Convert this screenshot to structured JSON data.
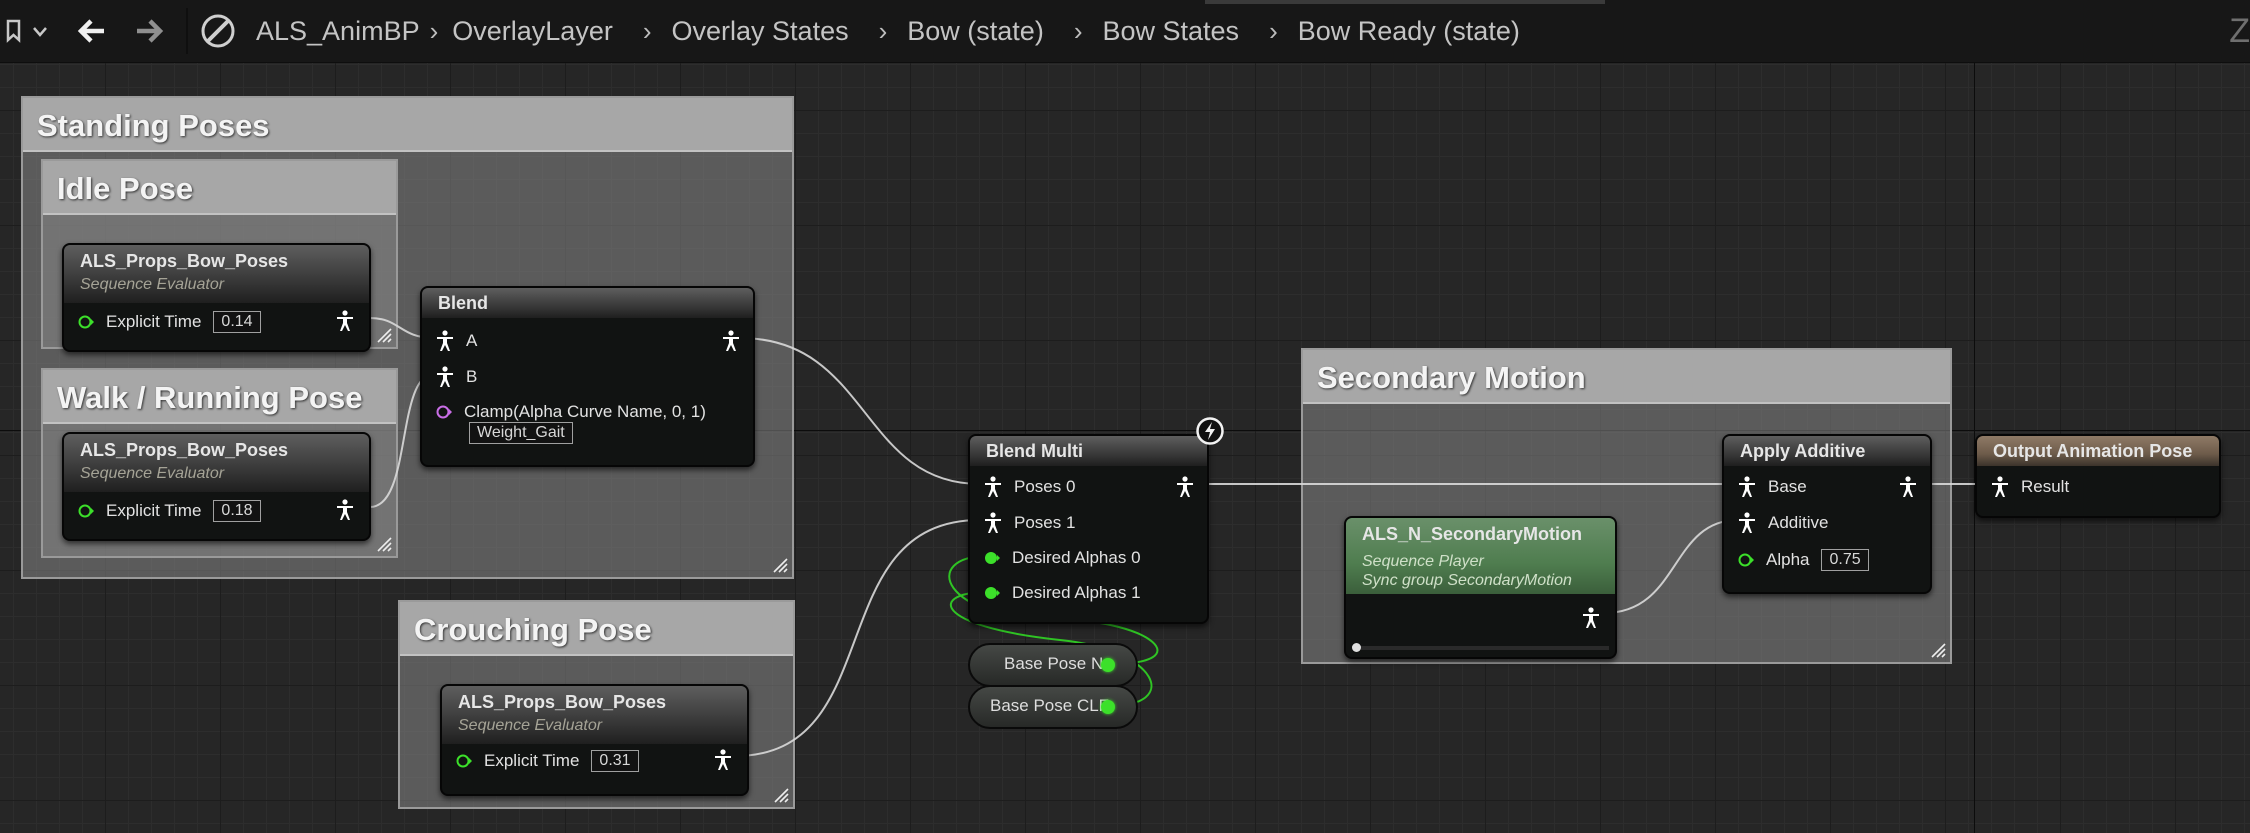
{
  "breadcrumb": {
    "items": [
      "ALS_AnimBP",
      "OverlayLayer",
      "Overlay States",
      "Bow (state)",
      "Bow States",
      "Bow Ready (state)"
    ]
  },
  "zoom_label": "Z",
  "comments": {
    "standing": "Standing Poses",
    "idle": "Idle Pose",
    "walk": "Walk / Running Pose",
    "crouch": "Crouching Pose",
    "secondary": "Secondary Motion"
  },
  "nodes": {
    "idle_eval": {
      "title": "ALS_Props_Bow_Poses",
      "subtitle": "Sequence Evaluator",
      "pin_label": "Explicit Time",
      "pin_value": "0.14"
    },
    "walk_eval": {
      "title": "ALS_Props_Bow_Poses",
      "subtitle": "Sequence Evaluator",
      "pin_label": "Explicit Time",
      "pin_value": "0.18"
    },
    "crouch_eval": {
      "title": "ALS_Props_Bow_Poses",
      "subtitle": "Sequence Evaluator",
      "pin_label": "Explicit Time",
      "pin_value": "0.31"
    },
    "blend": {
      "title": "Blend",
      "pin_a": "A",
      "pin_b": "B",
      "alpha_label": "Clamp(Alpha Curve Name, 0, 1)",
      "alpha_value": "Weight_Gait"
    },
    "blend_multi": {
      "title": "Blend Multi",
      "pins": [
        "Poses 0",
        "Poses 1",
        "Desired Alphas 0",
        "Desired Alphas 1"
      ]
    },
    "base_pose_n": {
      "label": "Base Pose N"
    },
    "base_pose_clf": {
      "label": "Base Pose CLF"
    },
    "seq_player": {
      "title": "ALS_N_SecondaryMotion",
      "subtitle": "Sequence Player",
      "subtitle2": "Sync group SecondaryMotion"
    },
    "apply_additive": {
      "title": "Apply Additive",
      "pin_base": "Base",
      "pin_additive": "Additive",
      "alpha_label": "Alpha",
      "alpha_value": "0.75"
    },
    "output_pose": {
      "title": "Output Animation Pose",
      "pin_result": "Result"
    }
  },
  "colors": {
    "pose_pin": "#ffffff",
    "float_pin": "#3ce02a",
    "name_pin": "#c96ee6",
    "seq_player_header": "#4f7d4f",
    "output_header": "#7d6a58"
  },
  "icons": [
    "bookmark-icon",
    "chevron-down-icon",
    "back-arrow-icon",
    "forward-arrow-icon",
    "graph-type-icon",
    "pose-pin-icon",
    "float-pin-icon",
    "fast-path-icon",
    "resize-grip-icon"
  ]
}
